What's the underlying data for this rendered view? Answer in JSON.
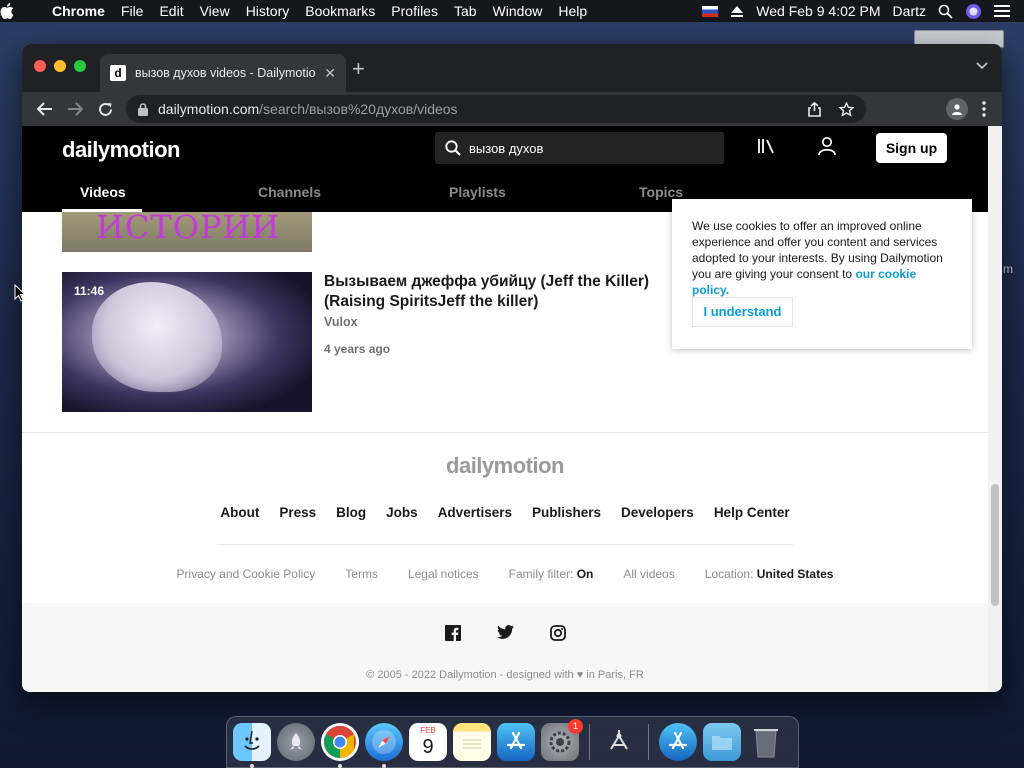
{
  "menubar": {
    "items": [
      "Chrome",
      "File",
      "Edit",
      "View",
      "History",
      "Bookmarks",
      "Profiles",
      "Tab",
      "Window",
      "Help"
    ],
    "clock": "Wed Feb 9  4:02 PM",
    "user": "Dartz"
  },
  "desktop": {
    "side_text": "m"
  },
  "browser": {
    "tab_favicon": "d",
    "tab_title": "вызов духов videos - Dailymotion",
    "url_host": "dailymotion.com",
    "url_path": "/search/вызов%20духов/videos"
  },
  "site": {
    "logo": "dailymotion",
    "search_value": "вызов духов",
    "signup_label": "Sign up",
    "tabs": [
      "Videos",
      "Channels",
      "Playlists",
      "Topics"
    ],
    "active_tab": "Videos",
    "top_thumb_text": "ИСТОРИИ",
    "video": {
      "duration": "11:46",
      "title": "Вызываем джеффа убийцу (Jeff the Killer) (Raising SpiritsJeff the killer)",
      "channel": "Vulox",
      "age": "4 years ago"
    },
    "cookie": {
      "text": "We use cookies to offer an improved online experience and offer you content and services adopted to your interests. By using Dailymotion you are giving your consent to ",
      "link": "our cookie policy.",
      "button": "I understand"
    },
    "footer": {
      "logo": "dailymotion",
      "links": [
        "About",
        "Press",
        "Blog",
        "Jobs",
        "Advertisers",
        "Publishers",
        "Developers",
        "Help Center"
      ],
      "legal": [
        "Privacy and Cookie Policy",
        "Terms",
        "Legal notices"
      ],
      "family_filter_label": "Family filter:",
      "family_filter_value": "On",
      "all_videos": "All videos",
      "location_label": "Location:",
      "location_value": "United States",
      "copyright": "© 2005 - 2022 Dailymotion - designed with ♥ in Paris, FR"
    }
  },
  "dock": {
    "calendar_month": "FEB",
    "calendar_day": "9",
    "settings_badge": "1"
  },
  "colors": {
    "brand_link": "#0d9dd6",
    "header_bg": "#000000"
  }
}
